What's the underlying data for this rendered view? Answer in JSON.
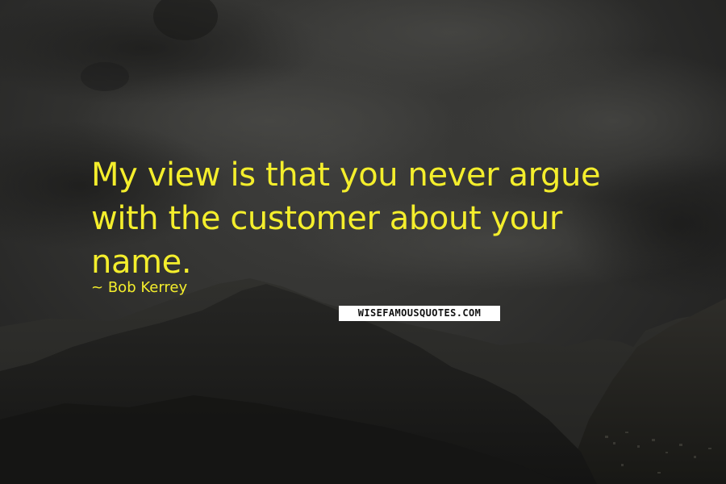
{
  "quote": {
    "text": "My view is that you never argue with the customer about your name.",
    "author_prefix": "~",
    "author": "Bob Kerrey",
    "text_color": "#f4ee2c"
  },
  "watermark": {
    "text": "WISEFAMOUSQUOTES.COM"
  },
  "background": {
    "scene": "dark cloudy sky over mountain range",
    "sky_color": "#333331",
    "mountain_color": "#1c1c1a"
  }
}
